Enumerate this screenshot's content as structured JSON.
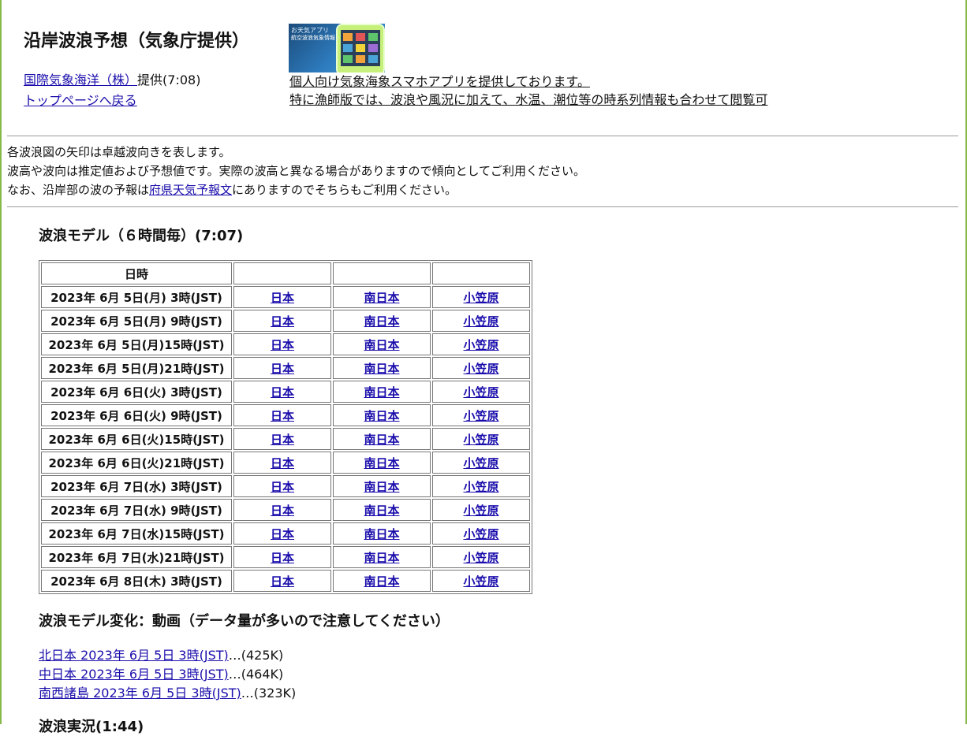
{
  "header": {
    "title": "沿岸波浪予想（気象庁提供）",
    "provider_link": "国際気象海洋（株）",
    "provider_suffix": "提供(7:08)",
    "top_link": "トップページへ戻る"
  },
  "app_promo": {
    "banner_text_1": "お天気アプリ",
    "banner_text_2": "航空波浪気象情報",
    "line1": "個人向け気象海象スマホアプリを提供しております。",
    "line2": "特に漁師版では、波浪や風況に加えて、水温、潮位等の時系列情報も合わせて閲覧可"
  },
  "notes": {
    "line1": "各波浪図の矢印は卓越波向きを表します。",
    "line2": "波高や波向は推定値および予想値です。実際の波高と異なる場合がありますので傾向としてご利用ください。",
    "line3_prefix": "なお、沿岸部の波の予報は",
    "line3_link": "府県天気予報文",
    "line3_suffix": "にありますのでそちらもご利用ください。"
  },
  "model": {
    "title": "波浪モデル（６時間毎）(7:07)",
    "header_label": "日時",
    "rows": [
      {
        "datetime": "2023年 6月 5日(月) 3時(JST)",
        "japan": "日本",
        "south": "南日本",
        "ogasawara": "小笠原"
      },
      {
        "datetime": "2023年 6月 5日(月) 9時(JST)",
        "japan": "日本",
        "south": "南日本",
        "ogasawara": "小笠原"
      },
      {
        "datetime": "2023年 6月 5日(月)15時(JST)",
        "japan": "日本",
        "south": "南日本",
        "ogasawara": "小笠原"
      },
      {
        "datetime": "2023年 6月 5日(月)21時(JST)",
        "japan": "日本",
        "south": "南日本",
        "ogasawara": "小笠原"
      },
      {
        "datetime": "2023年 6月 6日(火) 3時(JST)",
        "japan": "日本",
        "south": "南日本",
        "ogasawara": "小笠原"
      },
      {
        "datetime": "2023年 6月 6日(火) 9時(JST)",
        "japan": "日本",
        "south": "南日本",
        "ogasawara": "小笠原"
      },
      {
        "datetime": "2023年 6月 6日(火)15時(JST)",
        "japan": "日本",
        "south": "南日本",
        "ogasawara": "小笠原"
      },
      {
        "datetime": "2023年 6月 6日(火)21時(JST)",
        "japan": "日本",
        "south": "南日本",
        "ogasawara": "小笠原"
      },
      {
        "datetime": "2023年 6月 7日(水) 3時(JST)",
        "japan": "日本",
        "south": "南日本",
        "ogasawara": "小笠原"
      },
      {
        "datetime": "2023年 6月 7日(水) 9時(JST)",
        "japan": "日本",
        "south": "南日本",
        "ogasawara": "小笠原"
      },
      {
        "datetime": "2023年 6月 7日(水)15時(JST)",
        "japan": "日本",
        "south": "南日本",
        "ogasawara": "小笠原"
      },
      {
        "datetime": "2023年 6月 7日(水)21時(JST)",
        "japan": "日本",
        "south": "南日本",
        "ogasawara": "小笠原"
      },
      {
        "datetime": "2023年 6月 8日(木) 3時(JST)",
        "japan": "日本",
        "south": "南日本",
        "ogasawara": "小笠原"
      }
    ]
  },
  "animation": {
    "title": "波浪モデル変化：動画（データ量が多いので注意してください）",
    "items": [
      {
        "link": "北日本 2023年 6月 5日 3時(JST)",
        "size": "…(425K)"
      },
      {
        "link": "中日本 2023年 6月 5日 3時(JST)",
        "size": "…(464K)"
      },
      {
        "link": "南西諸島 2023年 6月 5日 3時(JST)",
        "size": "…(323K)"
      }
    ]
  },
  "next_section_title": "波浪実況(1:44)"
}
